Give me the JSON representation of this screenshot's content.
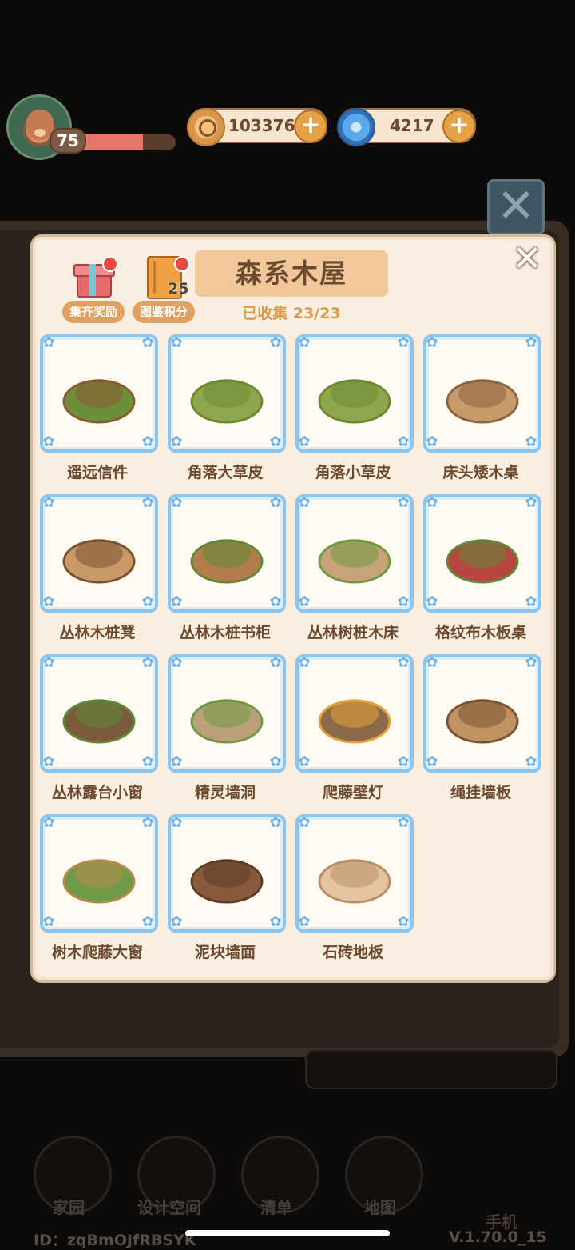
{
  "hud": {
    "level": "75",
    "xp_progress": 0.67,
    "coins": "103376",
    "gems": "4217"
  },
  "panel": {
    "title": "森系木屋",
    "collected_label": "已收集 23/23",
    "reward_button": "集齐奖励",
    "score_button": "图鉴积分",
    "score_count": "25"
  },
  "items": [
    {
      "name": "遥远信件",
      "icon": "letter-box-icon"
    },
    {
      "name": "角落大草皮",
      "icon": "large-grass-patch-icon"
    },
    {
      "name": "角落小草皮",
      "icon": "small-grass-patch-icon"
    },
    {
      "name": "床头矮木桌",
      "icon": "low-wood-table-icon"
    },
    {
      "name": "丛林木桩凳",
      "icon": "stump-stool-icon"
    },
    {
      "name": "丛林木桩书柜",
      "icon": "stump-bookshelf-icon"
    },
    {
      "name": "丛林树桩木床",
      "icon": "stump-bed-icon"
    },
    {
      "name": "格纹布木板桌",
      "icon": "plaid-cloth-table-icon"
    },
    {
      "name": "丛林露台小窗",
      "icon": "jungle-window-icon"
    },
    {
      "name": "精灵墙洞",
      "icon": "fairy-wall-hole-icon"
    },
    {
      "name": "爬藤壁灯",
      "icon": "vine-wall-lamp-icon"
    },
    {
      "name": "绳挂墙板",
      "icon": "rope-wall-board-icon"
    },
    {
      "name": "树木爬藤大窗",
      "icon": "vine-large-window-icon"
    },
    {
      "name": "泥块墙面",
      "icon": "mud-wall-icon"
    },
    {
      "name": "石砖地板",
      "icon": "stone-floor-icon"
    }
  ],
  "nav": {
    "home": "家园",
    "design": "设计空间",
    "list": "清单",
    "map": "地图",
    "phone": "手机"
  },
  "footer": {
    "id": "ID：zqBmOJfRBSYK",
    "version": "V.1.70.0_15"
  }
}
